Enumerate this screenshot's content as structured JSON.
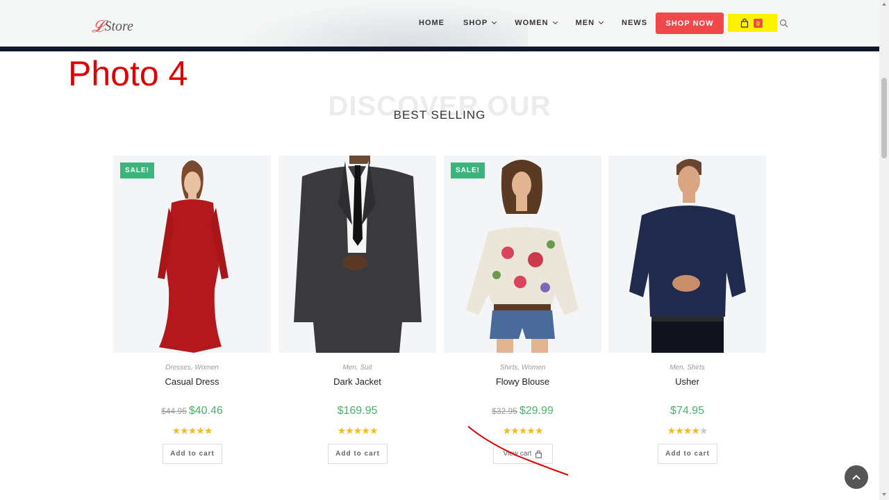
{
  "header": {
    "logo_mark": "𝓛",
    "logo_text": "Store",
    "nav": [
      {
        "label": "HOME",
        "has_dropdown": false
      },
      {
        "label": "SHOP",
        "has_dropdown": true
      },
      {
        "label": "WOMEN",
        "has_dropdown": true
      },
      {
        "label": "MEN",
        "has_dropdown": true
      },
      {
        "label": "NEWS",
        "has_dropdown": false
      }
    ],
    "cta_label": "SHOP NOW",
    "cart_count": "0",
    "icons": {
      "cart": "shopping-bag-icon",
      "search": "search-icon"
    }
  },
  "annotation": {
    "label": "Photo 4",
    "color": "#e00000"
  },
  "section": {
    "background_title": "DISCOVER OUR",
    "title": "BEST SELLING"
  },
  "products": [
    {
      "name": "Casual Dress",
      "categories": "Dresses, Women",
      "sale_badge": "SALE!",
      "old_price": "$44.95",
      "price": "$40.46",
      "rating_stars": 5,
      "button": "Add to cart"
    },
    {
      "name": "Dark Jacket",
      "categories": "Men, Suit",
      "sale_badge": "",
      "old_price": "",
      "price": "$169.95",
      "rating_stars": 5,
      "button": "Add to cart"
    },
    {
      "name": "Flowy Blouse",
      "categories": "Shirts, Women",
      "sale_badge": "SALE!",
      "old_price": "$32.95",
      "price": "$29.99",
      "rating_stars": 5,
      "button": "View cart"
    },
    {
      "name": "Usher",
      "categories": "Men, Shirts",
      "sale_badge": "",
      "old_price": "",
      "price": "$74.95",
      "rating_stars": 4,
      "button": "Add to cart"
    }
  ],
  "colors": {
    "accent": "#f0494c",
    "price": "#4bb369",
    "sale": "#3bb57d",
    "stars": "#f5b921",
    "highlight": "#fff200"
  }
}
